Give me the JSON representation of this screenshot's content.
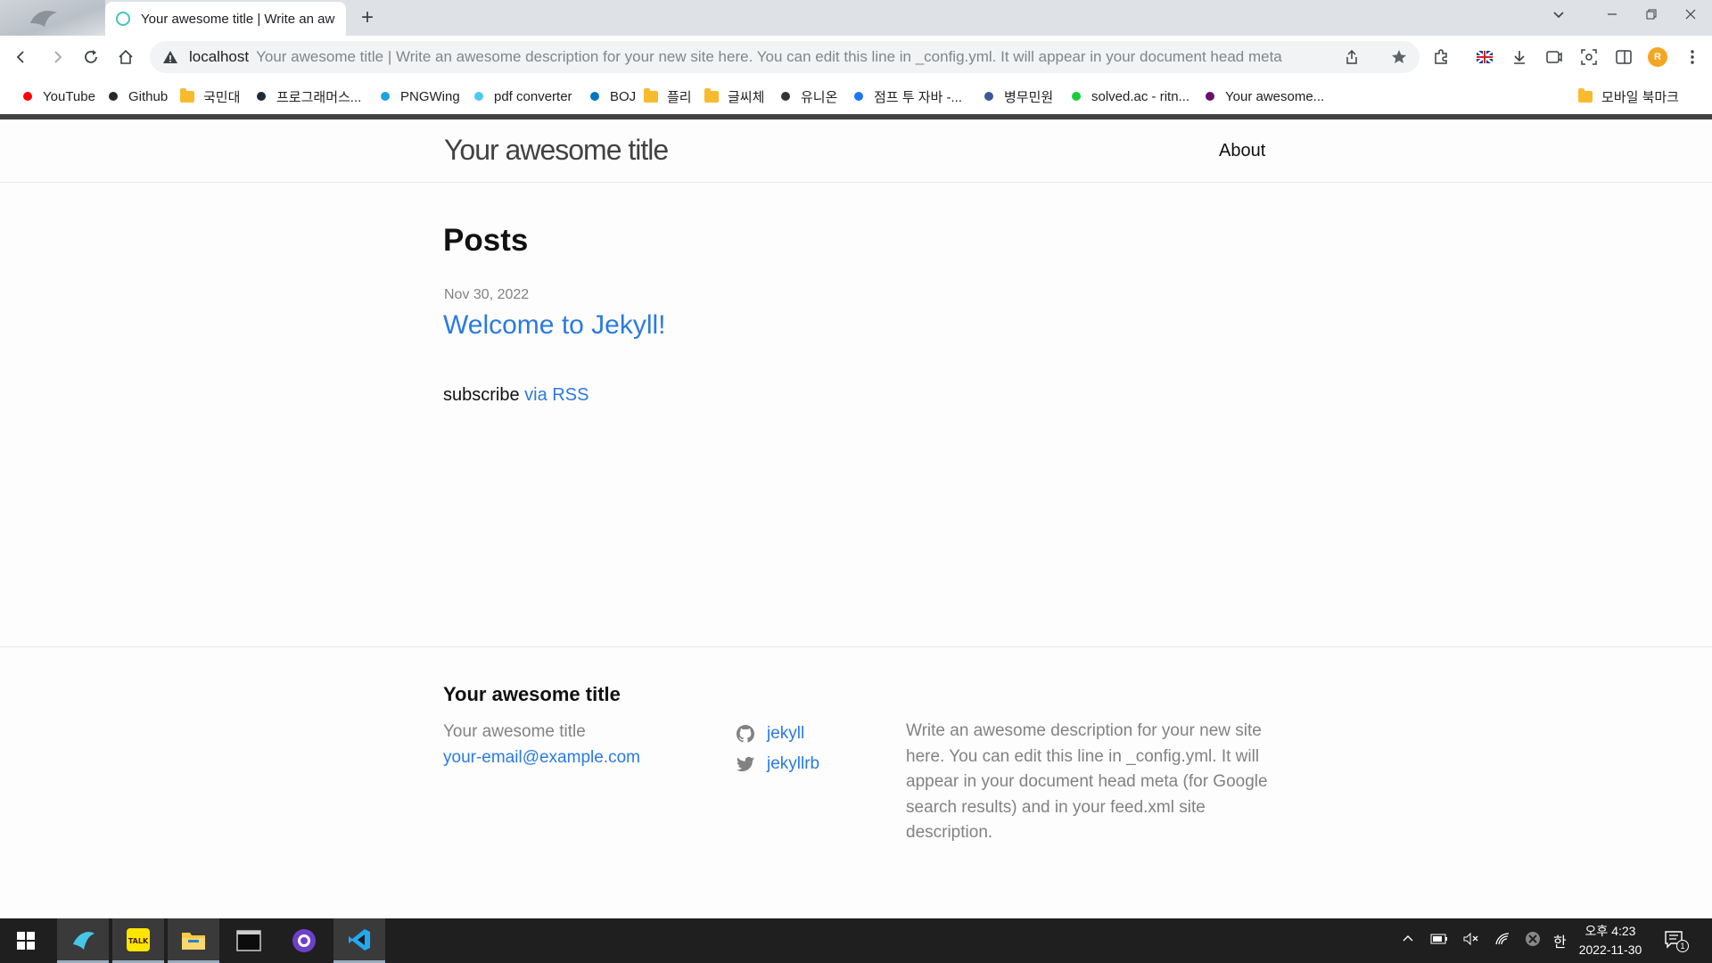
{
  "browser": {
    "tab": {
      "title": "Your awesome title | Write an awesome description for your new site here."
    },
    "omnibox": {
      "host": "localhost",
      "page_title": "Your awesome title | Write an awesome description for your new site here. You can edit this line in _config.yml. It will appear in your document head meta"
    },
    "avatar_letter": "R",
    "bookmarks": [
      {
        "label": "YouTube",
        "icon": "dot",
        "color": "#ff0000"
      },
      {
        "label": "Github",
        "icon": "dot",
        "color": "#24292e"
      },
      {
        "label": "국민대",
        "icon": "folder"
      },
      {
        "label": "프로그래머스...",
        "icon": "dot",
        "color": "#1e2a38"
      },
      {
        "label": "PNGWing",
        "icon": "dot",
        "color": "#1fa3e0"
      },
      {
        "label": "pdf converter",
        "icon": "dot",
        "color": "#4cc9f0"
      },
      {
        "label": "BOJ",
        "icon": "dot",
        "color": "#0076c0"
      },
      {
        "label": "플리",
        "icon": "folder"
      },
      {
        "label": "글씨체",
        "icon": "folder"
      },
      {
        "label": "유니온",
        "icon": "dot",
        "color": "#333333"
      },
      {
        "label": "점프 투 자바 -...",
        "icon": "dot",
        "color": "#1877f2"
      },
      {
        "label": "병무민원",
        "icon": "dot",
        "color": "#3b5998"
      },
      {
        "label": "solved.ac - ritn...",
        "icon": "dot",
        "color": "#17ce3a"
      },
      {
        "label": "Your awesome...",
        "icon": "dot",
        "color": "#6a0f6a"
      }
    ],
    "mobile_bookmarks": "모바일 북마크"
  },
  "site": {
    "title": "Your awesome title",
    "nav": {
      "about": "About"
    },
    "posts_heading": "Posts",
    "posts": [
      {
        "date": "Nov 30, 2022",
        "title": "Welcome to Jekyll!"
      }
    ],
    "subscribe_text": "subscribe",
    "subscribe_link": "via RSS",
    "footer": {
      "heading": "Your awesome title",
      "name": "Your awesome title",
      "email": "your-email@example.com",
      "github": "jekyll",
      "twitter": "jekyllrb",
      "description": "Write an awesome description for your new site here. You can edit this line in _config.yml. It will appear in your document head meta (for Google search results) and in your feed.xml site description."
    }
  },
  "taskbar": {
    "time": "오후 4:23",
    "date": "2022-11-30",
    "ime": "한",
    "notification_count": "1"
  }
}
